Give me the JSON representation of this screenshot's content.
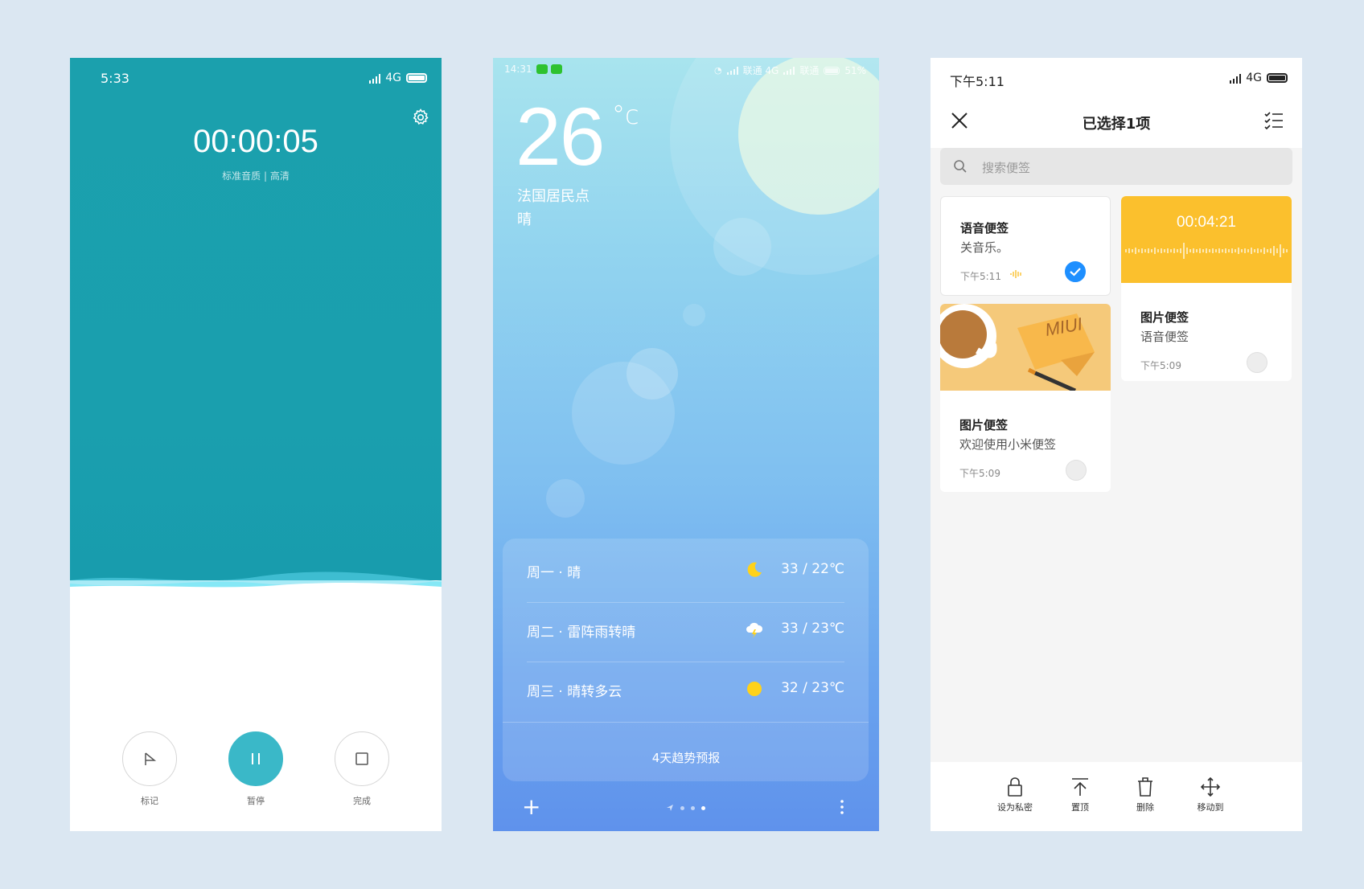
{
  "recorder": {
    "status": {
      "time": "5:33",
      "network": "4G"
    },
    "timer": "00:00:05",
    "quality": "标准音质 | 高清",
    "buttons": {
      "mark": "标记",
      "pause": "暂停",
      "done": "完成"
    }
  },
  "weather": {
    "status": {
      "time": "14:31",
      "carrier1": "联通 4G",
      "carrier2": "联通",
      "battery": "51%"
    },
    "temperature": "26",
    "unit": "°c",
    "location": "法国居民点",
    "condition": "晴",
    "forecast": [
      {
        "day": "周一 · 晴",
        "icon": "moon-icon",
        "temp": "33 / 22℃"
      },
      {
        "day": "周二 · 雷阵雨转晴",
        "icon": "thunder-cloud-icon",
        "temp": "33 / 23℃"
      },
      {
        "day": "周三 · 晴转多云",
        "icon": "sun-icon",
        "temp": "32 / 23℃"
      }
    ],
    "trend_link": "4天趋势预报",
    "add_symbol": "+"
  },
  "notes": {
    "status": {
      "time": "下午5:11",
      "network": "4G"
    },
    "title": "已选择1项",
    "search_placeholder": "搜索便签",
    "items": [
      {
        "title": "语音便签",
        "body": "关音乐。",
        "time": "下午5:11",
        "selected": true
      },
      {
        "header_time": "00:04:21",
        "title": "图片便签",
        "body": "语音便签",
        "time": "下午5:09",
        "selected": false
      },
      {
        "image_text": "MIUI",
        "title": "图片便签",
        "body": "欢迎使用小米便签",
        "time": "下午5:09",
        "selected": false
      }
    ],
    "actions": {
      "private": "设为私密",
      "pin": "置顶",
      "delete": "删除",
      "move": "移动到"
    },
    "colors": {
      "accent": "#1e8fff",
      "voice_header": "#fbc02d"
    }
  }
}
